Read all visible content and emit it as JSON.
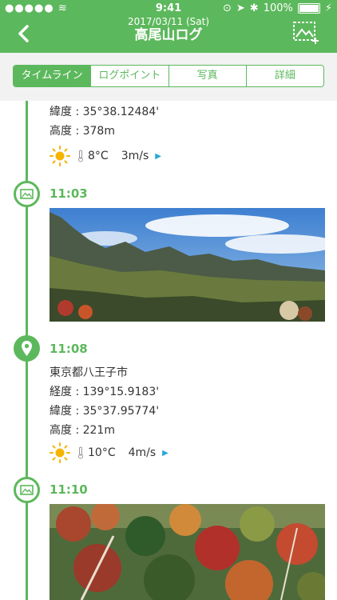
{
  "status": {
    "time": "9:41",
    "battery": "100%"
  },
  "header": {
    "date": "2017/03/11 (Sat)",
    "title": "高尾山ログ"
  },
  "tabs": [
    {
      "label": "タイムライン",
      "active": true
    },
    {
      "label": "ログポイント",
      "active": false
    },
    {
      "label": "写真",
      "active": false
    },
    {
      "label": "詳細",
      "active": false
    }
  ],
  "timeline": {
    "partial": {
      "latitude": "緯度 : 35°38.12484'",
      "altitude": "高度 : 378m",
      "temp": "8°C",
      "wind": "3m/s"
    },
    "entry1": {
      "time": "11:03"
    },
    "entry2": {
      "time": "11:08",
      "location": "東京都八王子市",
      "longitude": "経度 : 139°15.9183'",
      "latitude": "緯度 : 35°37.95774'",
      "altitude": "高度 : 221m",
      "temp": "10°C",
      "wind": "4m/s"
    },
    "entry3": {
      "time": "11:10"
    }
  },
  "colors": {
    "accent": "#5cb85c",
    "wind_arrow": "#2aa9d6",
    "sun": "#f5b400"
  }
}
